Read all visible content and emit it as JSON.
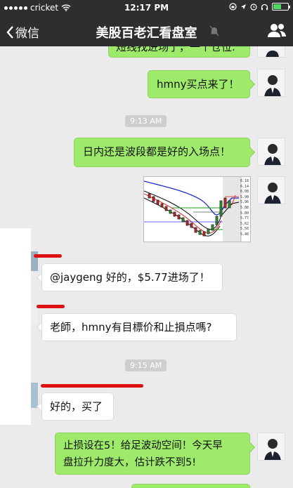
{
  "status_bar": {
    "carrier": "cricket",
    "time": "12:17 PM"
  },
  "nav": {
    "back_label": "微信",
    "title": "美股百老汇看盘室"
  },
  "messages": {
    "m0": "短线找进场了，一个仓位.",
    "m1": "hmny买点来了！",
    "ts1": "9:13 AM",
    "m2": "日内还是波段都是好的入场点！",
    "m3": "@jaygeng 好的，$5.77进场了！",
    "m4": "老師，hmny有目標价和止損点嗎?",
    "ts2": "9:15 AM",
    "m5": "好的，买了",
    "m6_line1": "止损设在5！给足波动空间！今天早",
    "m6_line2": "盘拉升力度大，估计跌不到5!"
  },
  "chart_prices": [
    "6.18",
    "6.14",
    "6.08",
    "5.98",
    "5.96",
    "5.88",
    "5.80",
    "5.77",
    "5.62",
    "5.50",
    "5.40"
  ],
  "colors": {
    "accent_green": "#9eea6a",
    "nav_bg": "#2e2e30",
    "redaction": "#d11111"
  }
}
